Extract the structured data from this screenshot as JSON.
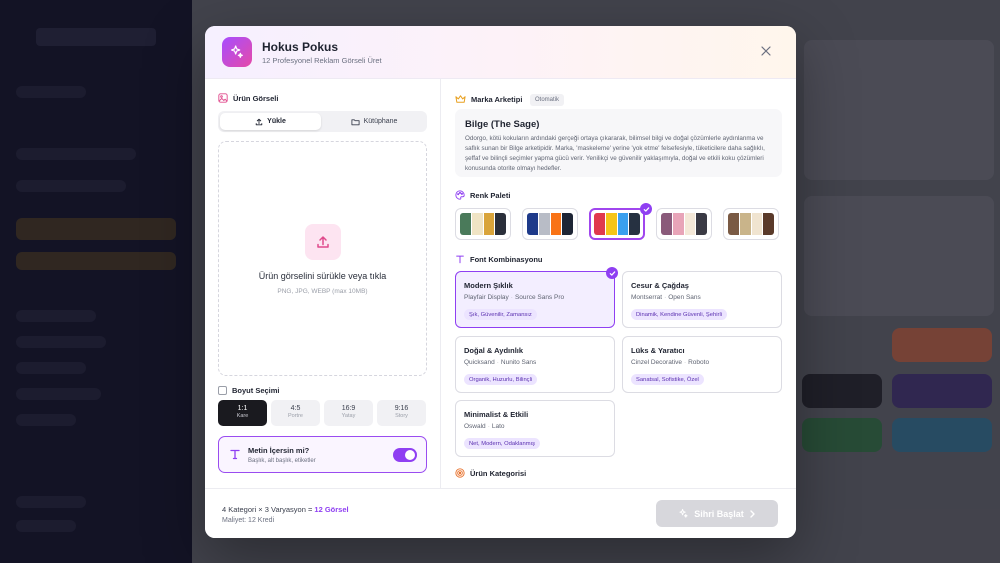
{
  "modal": {
    "title": "Hokus Pokus",
    "subtitle": "12 Profesyonel Reklam Görseli Üret"
  },
  "upload": {
    "heading": "Ürün Görseli",
    "tabs": [
      {
        "label": "Yükle",
        "icon": "upload-icon",
        "active": true
      },
      {
        "label": "Kütüphane",
        "icon": "folder-icon",
        "active": false
      }
    ],
    "drop_title": "Ürün görselini sürükle veya tıkla",
    "drop_hint": "PNG, JPG, WEBP (max 10MB)"
  },
  "size": {
    "heading": "Boyut Seçimi",
    "options": [
      {
        "ratio": "1:1",
        "name": "Kare",
        "active": true
      },
      {
        "ratio": "4:5",
        "name": "Portre",
        "active": false
      },
      {
        "ratio": "16:9",
        "name": "Yatay",
        "active": false
      },
      {
        "ratio": "9:16",
        "name": "Story",
        "active": false
      }
    ]
  },
  "text_toggle": {
    "title": "Metin İçersin mi?",
    "subtitle": "Başlık, alt başlık, etiketler",
    "enabled": true
  },
  "archetype": {
    "heading": "Marka Arketipi",
    "badge": "Otomatik",
    "name": "Bilge (The Sage)",
    "description": "Odorgo, kötü kokuların ardındaki gerçeği ortaya çıkararak, bilimsel bilgi ve doğal çözümlerle aydınlanma ve saflık sunan bir Bilge arketipidir. Marka, 'maskeleme' yerine 'yok etme' felsefesiyle, tüketicilere daha sağlıklı, şeffaf ve bilinçli seçimler yapma gücü verir. Yenilikçi ve güvenilir yaklaşımıyla, doğal ve etkili koku çözümleri konusunda otorite olmayı hedefler."
  },
  "palette": {
    "heading": "Renk Paleti",
    "selected_index": 2,
    "options": [
      {
        "colors": [
          "#4a7a5a",
          "#f0e4c4",
          "#d9a43a",
          "#2a2f3a"
        ]
      },
      {
        "colors": [
          "#1e3a8a",
          "#b8bcc6",
          "#f97316",
          "#1e2535"
        ]
      },
      {
        "colors": [
          "#e0394e",
          "#f5c518",
          "#3aa0ee",
          "#263141"
        ]
      },
      {
        "colors": [
          "#8a5a7a",
          "#e8a4b8",
          "#f4e8d8",
          "#3a3a44"
        ]
      },
      {
        "colors": [
          "#7a5a44",
          "#c9b48a",
          "#f0e4d0",
          "#5a3a2a"
        ]
      }
    ]
  },
  "fonts": {
    "heading": "Font Kombinasyonu",
    "selected_index": 0,
    "options": [
      {
        "name": "Modern Şıklık",
        "primary": "Playfair Display",
        "secondary": "Source Sans Pro",
        "tags": "Şık, Güvenilir, Zamansız"
      },
      {
        "name": "Cesur & Çağdaş",
        "primary": "Montserrat",
        "secondary": "Open Sans",
        "tags": "Dinamik, Kendine Güvenli, Şehirli"
      },
      {
        "name": "Doğal & Aydınlık",
        "primary": "Quicksand",
        "secondary": "Nunito Sans",
        "tags": "Organik, Huzurlu, Bilinçli"
      },
      {
        "name": "Lüks & Yaratıcı",
        "primary": "Cinzel Decorative",
        "secondary": "Roboto",
        "tags": "Sanatsal, Sofistike, Özel"
      },
      {
        "name": "Minimalist & Etkili",
        "primary": "Oswald",
        "secondary": "Lato",
        "tags": "Net, Modern, Odaklanmış"
      }
    ]
  },
  "category": {
    "heading": "Ürün Kategorisi"
  },
  "footer": {
    "formula_prefix": "4 Kategori × 3 Varyasyon = ",
    "formula_result": "12 Görsel",
    "cost": "Maliyet: 12 Kredi",
    "start_label": "Sihri Başlat",
    "start_enabled": false
  },
  "colors": {
    "accent": "#8f3ff2",
    "brand_gradient_start": "#a64dff",
    "brand_gradient_end": "#e64aa8"
  }
}
